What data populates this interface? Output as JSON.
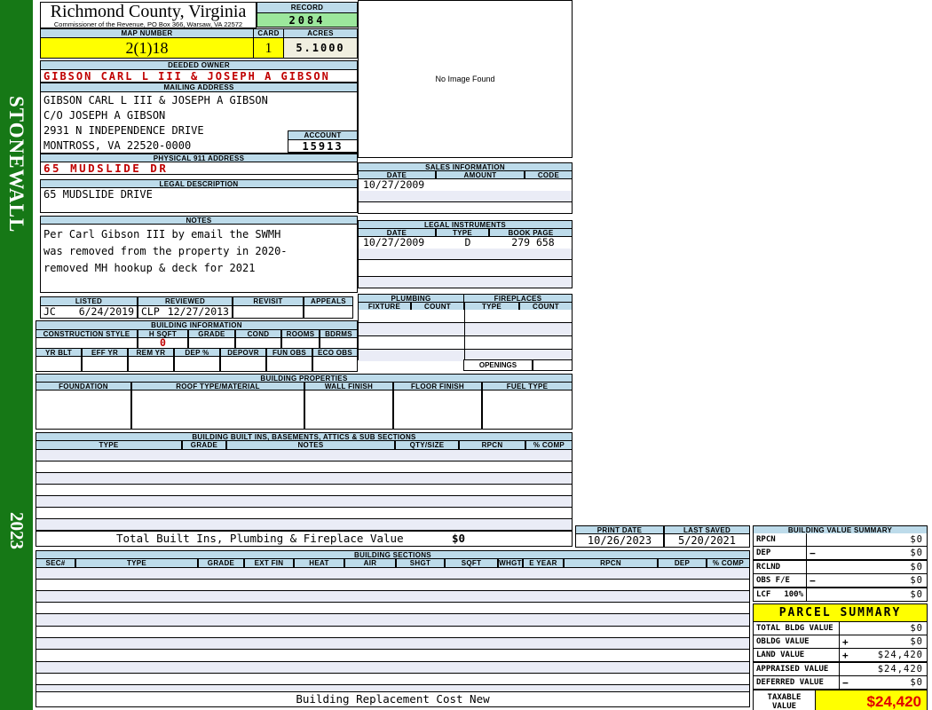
{
  "sidebar": {
    "district": "STONEWALL",
    "year": "2023"
  },
  "header": {
    "county": "Richmond County, Virginia",
    "sub": "Commissioner of the Revenue, PO Box 366, Warsaw, VA 22572",
    "record_label": "RECORD",
    "record": "2084",
    "map_number_label": "MAP NUMBER",
    "map_number": "2(1)18",
    "card_label": "CARD",
    "card": "1",
    "acres_label": "ACRES",
    "acres": "5.1000"
  },
  "owner": {
    "deeded_label": "DEEDED OWNER",
    "deeded": "GIBSON CARL L III & JOSEPH A GIBSON",
    "mailing_label": "MAILING ADDRESS",
    "mailing_lines": {
      "0": "GIBSON CARL L III & JOSEPH A GIBSON",
      "1": "C/O JOSEPH A GIBSON",
      "2": "2931 N INDEPENDENCE DRIVE",
      "3": "MONTROSS, VA 22520-0000"
    },
    "account_label": "ACCOUNT",
    "account": "15913",
    "physical_label": "PHYSICAL 911 ADDRESS",
    "physical": "65 MUDSLIDE DR",
    "legal_label": "LEGAL DESCRIPTION",
    "legal": "65 MUDSLIDE DRIVE"
  },
  "notes": {
    "label": "NOTES",
    "lines": {
      "0": "Per Carl Gibson III by email the SWMH",
      "1": "was removed from the property in 2020-",
      "2": "removed MH hookup & deck for 2021"
    }
  },
  "review": {
    "headers": {
      "0": "LISTED",
      "1": "REVIEWED",
      "2": "REVISIT",
      "3": "APPEALS"
    },
    "listed_by": "JC",
    "listed_date": "6/24/2019",
    "reviewed_by": "CLP",
    "reviewed_date": "12/27/2013"
  },
  "building_info": {
    "title": "BUILDING INFORMATION",
    "row1": {
      "0": "CONSTRUCTION STYLE",
      "1": "H SQFT",
      "2": "GRADE",
      "3": "COND",
      "4": "ROOMS",
      "5": "BDRMS"
    },
    "h_sqft": "0",
    "row2": {
      "0": "YR BLT",
      "1": "EFF YR",
      "2": "REM YR",
      "3": "DEP %",
      "4": "DEPOVR",
      "5": "FUN OBS",
      "6": "ECO OBS"
    }
  },
  "building_properties": {
    "title": "BUILDING PROPERTIES",
    "headers": {
      "0": "FOUNDATION",
      "1": "ROOF TYPE/MATERIAL",
      "2": "WALL FINISH",
      "3": "FLOOR FINISH",
      "4": "FUEL TYPE"
    }
  },
  "built_ins": {
    "title": "BUILDING BUILT INS, BASEMENTS, ATTICS & SUB SECTIONS",
    "headers": {
      "0": "TYPE",
      "1": "GRADE",
      "2": "NOTES",
      "3": "QTY/SIZE",
      "4": "RPCN",
      "5": "% COMP"
    },
    "total_label": "Total Built Ins, Plumbing & Fireplace Value",
    "total_value": "$0"
  },
  "image_box": {
    "text": "No Image Found"
  },
  "sales": {
    "title": "SALES INFORMATION",
    "headers": {
      "0": "DATE",
      "1": "AMOUNT",
      "2": "CODE"
    },
    "rows": {
      "0": {
        "date": "10/27/2009",
        "amount": "",
        "code": ""
      }
    }
  },
  "legal_instruments": {
    "title": "LEGAL INSTRUMENTS",
    "headers": {
      "0": "DATE",
      "1": "TYPE",
      "2": "BOOK PAGE"
    },
    "rows": {
      "0": {
        "date": "10/27/2009",
        "type": "D",
        "bookpage": "279 658"
      }
    }
  },
  "plumbing": {
    "title": "PLUMBING",
    "headers": {
      "0": "FIXTURE",
      "1": "COUNT"
    }
  },
  "fireplaces": {
    "title": "FIREPLACES",
    "headers": {
      "0": "TYPE",
      "1": "COUNT"
    },
    "openings_label": "OPENINGS"
  },
  "dates": {
    "print_date_label": "PRINT DATE",
    "print_date": "10/26/2023",
    "last_saved_label": "LAST SAVED",
    "last_saved": "5/20/2021"
  },
  "building_sections": {
    "title": "BUILDING SECTIONS",
    "headers": {
      "0": "SEC#",
      "1": "TYPE",
      "2": "GRADE",
      "3": "EXT FIN",
      "4": "HEAT",
      "5": "AIR",
      "6": "SHGT",
      "7": "SQFT",
      "8": "WHGT",
      "9": "E YEAR",
      "10": "RPCN",
      "11": "DEP",
      "12": "% COMP"
    },
    "footer": "Building Replacement Cost New"
  },
  "building_value_summary": {
    "title": "BUILDING VALUE SUMMARY",
    "rows": {
      "0": {
        "label": "RPCN",
        "op": "",
        "value": "$0"
      },
      "1": {
        "label": "DEP",
        "op": "−",
        "value": "$0"
      },
      "2": {
        "label": "RCLND",
        "op": "",
        "value": "$0"
      },
      "3": {
        "label": "OBS F/E",
        "op": "−",
        "value": "$0"
      },
      "4": {
        "label": "LCF",
        "pct": "100%",
        "op": "",
        "value": "$0"
      }
    }
  },
  "parcel_summary": {
    "title": "PARCEL SUMMARY",
    "rows": {
      "0": {
        "label": "TOTAL BLDG VALUE",
        "op": "",
        "value": "$0"
      },
      "1": {
        "label": "OBLDG VALUE",
        "op": "+",
        "value": "$0"
      },
      "2": {
        "label": "LAND VALUE",
        "op": "+",
        "value": "$24,420"
      },
      "3": {
        "label": "APPRAISED VALUE",
        "op": "",
        "value": "$24,420"
      },
      "4": {
        "label": "DEFERRED VALUE",
        "op": "−",
        "value": "$0"
      }
    },
    "taxable_label": "TAXABLE VALUE",
    "taxable_value": "$24,420"
  },
  "colors": {
    "sidebar_green": "#167816",
    "header_blue": "#BDDBEA",
    "record_green": "#9CE79C",
    "highlight_yellow": "#FFFF00",
    "acres_beige": "#F0EFE0",
    "alt_row": "#EAECF6",
    "alert_red": "#C00000"
  }
}
